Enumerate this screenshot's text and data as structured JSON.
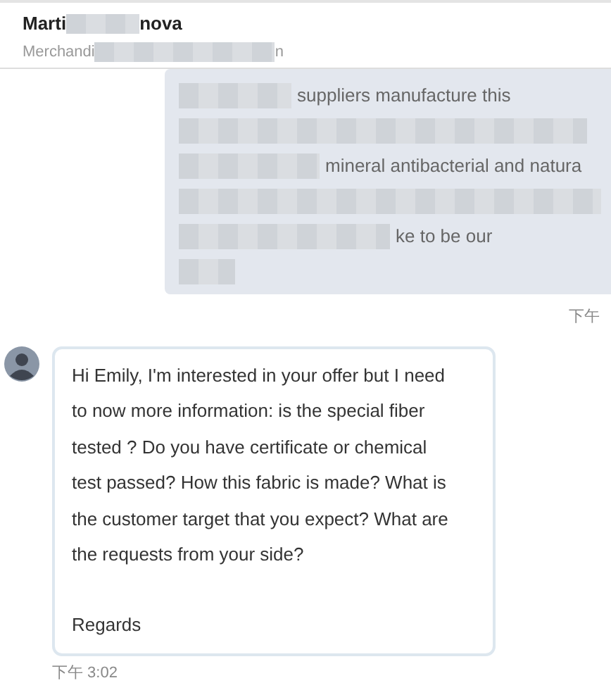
{
  "contact": {
    "name_parts": [
      "Marti",
      "nova"
    ],
    "subtitle_parts": [
      "Merchandi",
      "n"
    ]
  },
  "messages": [
    {
      "kind": "outgoing",
      "lines": [
        {
          "text": "suppliers manufacture this",
          "masked": true
        },
        {
          "masked": true
        },
        {
          "text": "mineral antibacterial and natura",
          "masked": true
        },
        {
          "masked": true
        },
        {
          "text": "ke to be our",
          "masked": true
        },
        {
          "masked": true
        }
      ],
      "time": "下午"
    },
    {
      "kind": "incoming",
      "paragraphs": [
        "Hi Emily, I'm interested in your offer but I need to now more information: is the special fiber tested ? Do you have certificate or chemical test passed? How this fabric is made? What is the customer target that you expect? What are the requests from your side?",
        "Regards"
      ],
      "time": "下午 3:02"
    }
  ]
}
